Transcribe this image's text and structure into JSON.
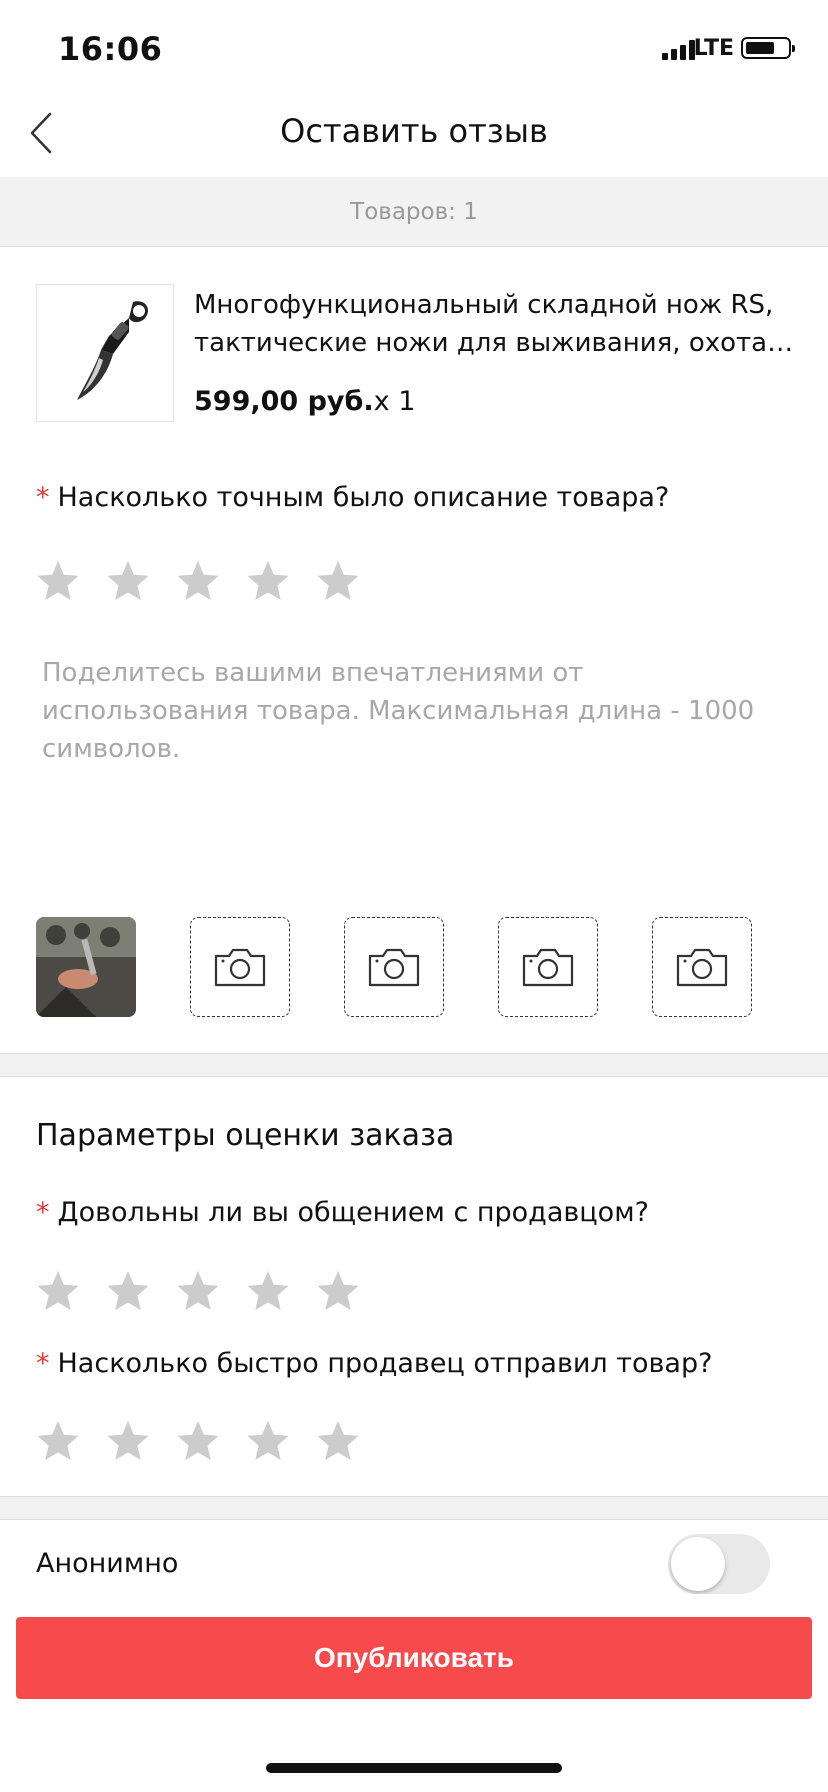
{
  "status_bar": {
    "time": "16:06",
    "network": "LTE"
  },
  "header": {
    "title": "Оставить отзыв",
    "back_icon": "chevron-left-icon"
  },
  "items_count": "Товаров: 1",
  "product": {
    "title_line1": "Многофункциональный складной нож RS,",
    "title_line2": "тактические ножи для выживания, охота,...",
    "price": "599,00 руб.",
    "quantity": "x 1"
  },
  "questions": {
    "description_accuracy": {
      "text": "Насколько точным было описание товара?",
      "required_mark": "*",
      "rating": 0,
      "max": 5
    },
    "seller_communication": {
      "text": "Довольны ли вы общением с продавцом?",
      "required_mark": "*",
      "rating": 0,
      "max": 5
    },
    "shipping_speed": {
      "text": "Насколько быстро продавец отправил товар?",
      "required_mark": "*",
      "rating": 0,
      "max": 5
    }
  },
  "review": {
    "value": "",
    "placeholder": "Поделитесь вашими впечатлениями от использования товара. Максимальная длина - 1000 символов."
  },
  "photos": {
    "uploaded": 1,
    "empty_slots": 4,
    "slot_icon": "camera-icon"
  },
  "order_section": {
    "title": "Параметры оценки заказа"
  },
  "anonymous": {
    "label": "Анонимно",
    "enabled": false
  },
  "publish_label": "Опубликовать",
  "colors": {
    "accent": "#f64a4d",
    "required": "#e53935",
    "star_inactive": "#cccccc",
    "muted_text": "#a8a8a8"
  }
}
